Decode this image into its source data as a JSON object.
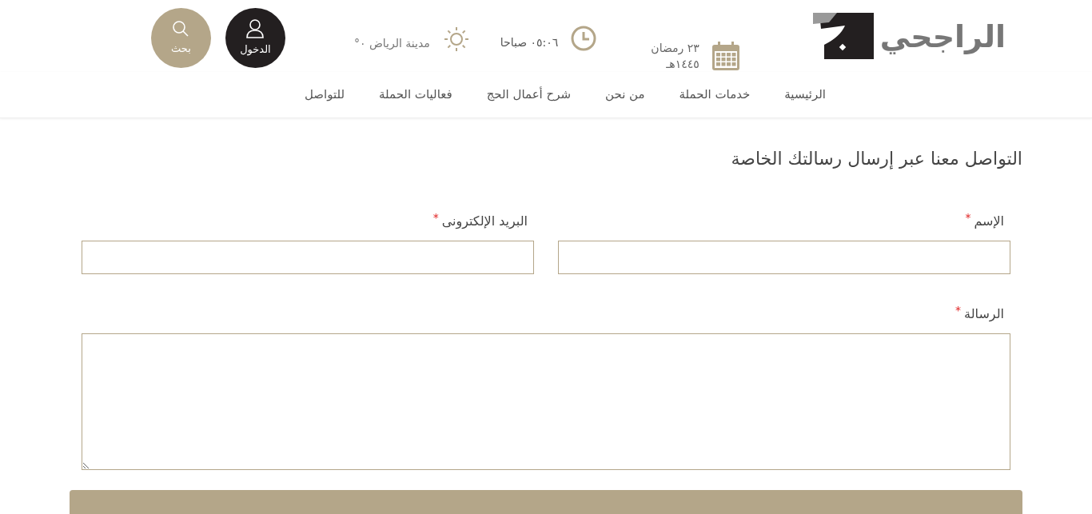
{
  "header": {
    "logo": "الراجحي",
    "date": {
      "day": "٢٣ رمضان",
      "year": "١٤٤٥هـ"
    },
    "time": "٠٥:٠٦ صباحا",
    "weather": "مدينة الرياض ٠°",
    "login": "الدخول",
    "search": "بحث"
  },
  "nav": [
    {
      "label": "الرئيسية"
    },
    {
      "label": "خدمات الحملة"
    },
    {
      "label": "من نحن"
    },
    {
      "label": "شرح أعمال الحج"
    },
    {
      "label": "فعاليات الحملة"
    },
    {
      "label": "للتواصل"
    }
  ],
  "form": {
    "title": "التواصل معنا عبر إرسال رسالتك الخاصة",
    "fields": [
      {
        "kind": "input",
        "label": "الإسم",
        "required_mark": "*"
      },
      {
        "kind": "input",
        "label": "البريد الإلكترونى",
        "required_mark": "*"
      },
      {
        "kind": "textarea",
        "label": "الرسالة",
        "required_mark": "*"
      }
    ]
  }
}
